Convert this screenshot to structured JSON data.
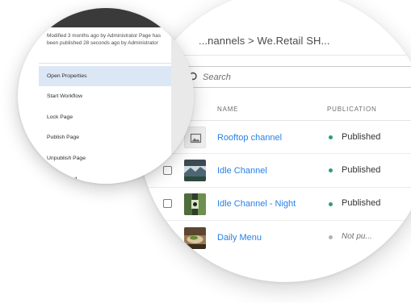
{
  "breadcrumb": "...nannels  >  We.Retail SH...",
  "search": {
    "placeholder": "Search"
  },
  "table": {
    "headers": {
      "name": "NAME",
      "publication": "PUBLICATION"
    },
    "rows": [
      {
        "name": "Rooftop channel",
        "status": "Published",
        "published": true,
        "thumb": "placeholder-image-icon"
      },
      {
        "name": "Idle Channel",
        "status": "Published",
        "published": true,
        "thumb": "mountain-photo-thumbnail"
      },
      {
        "name": "Idle Channel - Night",
        "status": "Published",
        "published": true,
        "thumb": "night-photo-thumbnail"
      },
      {
        "name": "Daily Menu",
        "status": "Not pu...",
        "published": false,
        "thumb": "food-photo-thumbnail"
      }
    ]
  },
  "context_menu": {
    "info": "Modified 3 months ago by Administrator Page has been published 28 seconds ago by Administrator",
    "items": [
      {
        "label": "Open Properties",
        "active": true
      },
      {
        "label": "Start Workflow",
        "active": false
      },
      {
        "label": "Lock Page",
        "active": false
      },
      {
        "label": "Publish Page",
        "active": false
      },
      {
        "label": "Unpublish Page",
        "active": false
      },
      {
        "label": "... Published",
        "active": false
      }
    ]
  },
  "colors": {
    "link": "#2680eb",
    "published_dot": "#2d9d78",
    "unpublished_dot": "#b3b3b3",
    "menu_active_bg": "#dce7f6"
  }
}
